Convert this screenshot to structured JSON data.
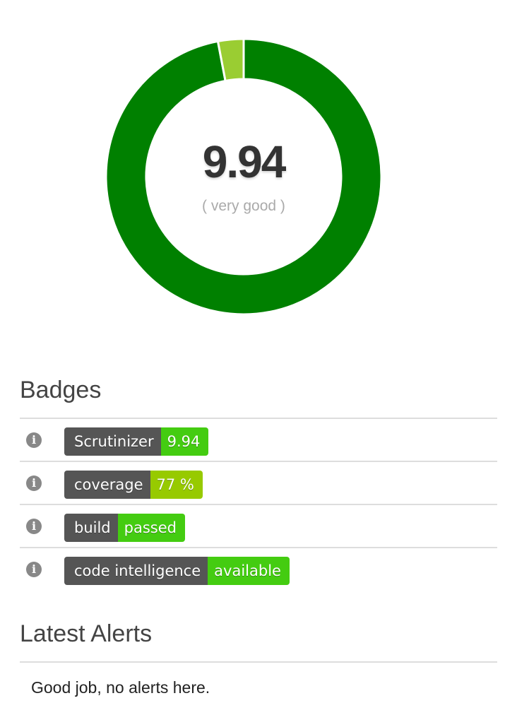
{
  "score": {
    "value": "9.94",
    "rating": "( very good )",
    "fraction": 0.97,
    "colors": {
      "main": "#008000",
      "remainder": "#9acd32"
    }
  },
  "badges_section": {
    "title": "Badges",
    "info_icon": "info-circle-icon",
    "items": [
      {
        "label": "Scrutinizer",
        "value": "9.94",
        "color": "#44cc11"
      },
      {
        "label": "coverage",
        "value": "77 %",
        "color": "#97ca00"
      },
      {
        "label": "build",
        "value": "passed",
        "color": "#44cc11"
      },
      {
        "label": "code intelligence",
        "value": "available",
        "color": "#44cc11"
      }
    ]
  },
  "alerts_section": {
    "title": "Latest Alerts",
    "empty_message": "Good job, no alerts here."
  }
}
